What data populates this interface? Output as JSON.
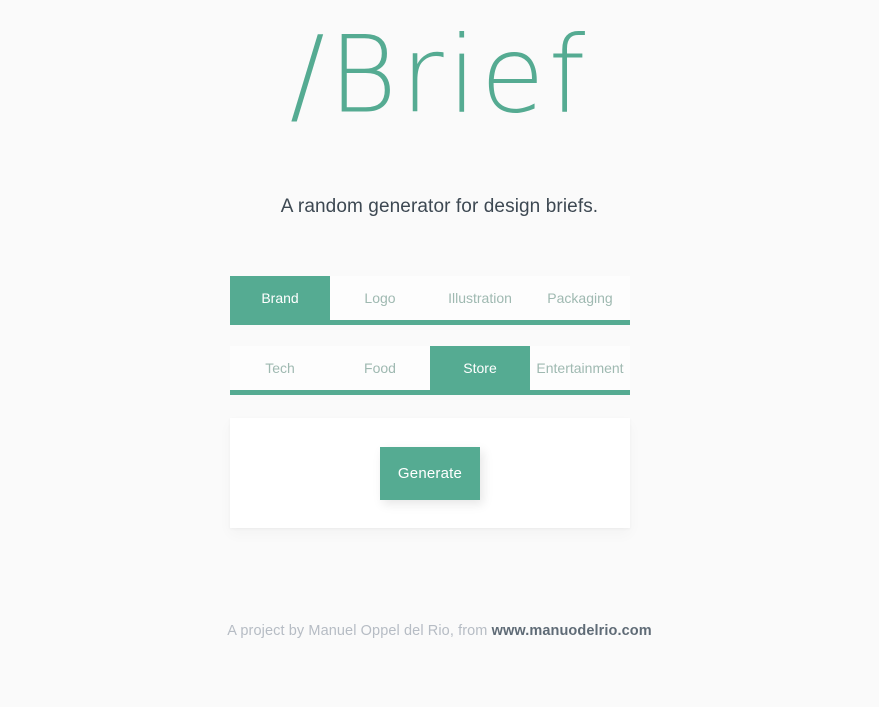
{
  "theme": {
    "accent": "#55ab92",
    "background": "#fafafa",
    "panel_background": "#ffffff",
    "tab_inactive_text": "#9fb9b1",
    "tagline_color": "#3d4852",
    "footer_text_color": "#b6bcc4",
    "footer_link_color": "#5f6b76"
  },
  "header": {
    "title": "/Brief",
    "tagline": "A random generator for design briefs."
  },
  "tabs": {
    "category_row": {
      "items": [
        {
          "label": "Brand",
          "active": true
        },
        {
          "label": "Logo",
          "active": false
        },
        {
          "label": "Illustration",
          "active": false
        },
        {
          "label": "Packaging",
          "active": false
        }
      ]
    },
    "sector_row": {
      "items": [
        {
          "label": "Tech",
          "active": false
        },
        {
          "label": "Food",
          "active": false
        },
        {
          "label": "Store",
          "active": true
        },
        {
          "label": "Entertainment",
          "active": false
        }
      ]
    }
  },
  "panel": {
    "generate_label": "Generate",
    "result_text": ""
  },
  "footer": {
    "credit_prefix": "A project by Manuel Oppel del Rio, from ",
    "link_label": "www.manuodelrio.com"
  }
}
